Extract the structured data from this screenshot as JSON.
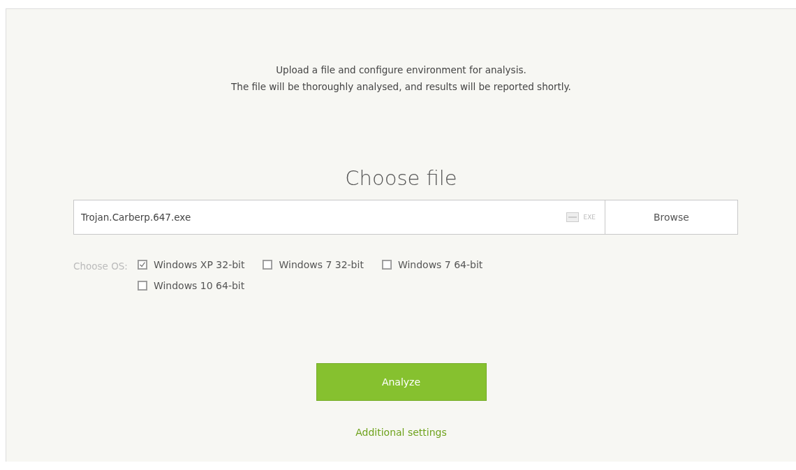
{
  "intro": [
    "Upload a file and configure environment for analysis.",
    "The file will be thoroughly analysed, and results will be reported shortly."
  ],
  "heading": "Choose file",
  "file_field": {
    "value": "Trojan.Carberp.647.exe",
    "type_label": "EXE"
  },
  "browse_button": "Browse",
  "os": {
    "label": "Choose OS:",
    "options": [
      {
        "label": "Windows XP 32-bit",
        "checked": true
      },
      {
        "label": "Windows 7 32-bit",
        "checked": false
      },
      {
        "label": "Windows 7 64-bit",
        "checked": false
      },
      {
        "label": "Windows 10 64-bit",
        "checked": false
      }
    ]
  },
  "analyze_button": "Analyze",
  "settings_link": "Additional settings"
}
